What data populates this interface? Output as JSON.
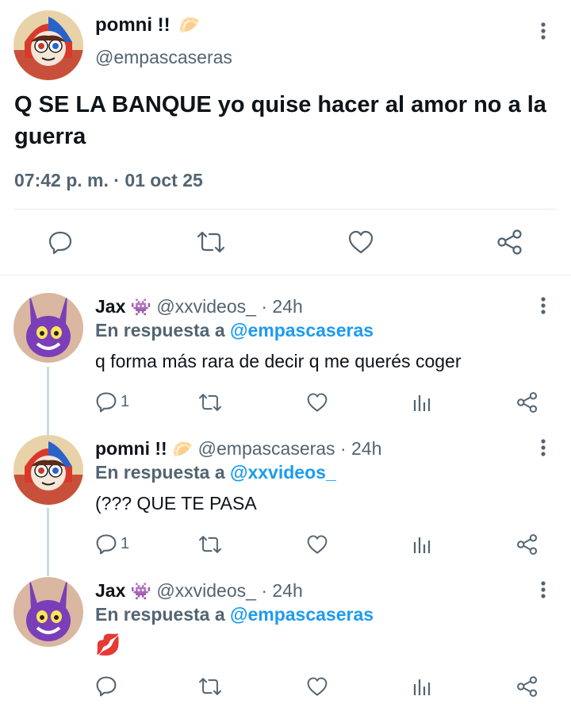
{
  "main_tweet": {
    "display_name": "pomni !!",
    "emoji": "🥟",
    "handle": "@empascaseras",
    "text": "Q SE LA BANQUE yo quise hacer al amor no a la guerra",
    "timestamp": "07:42 p. m. · 01 oct 25",
    "avatar_icon": "pomni-avatar"
  },
  "replies": [
    {
      "display_name": "Jax",
      "emoji": "👾",
      "handle": "@xxvideos_",
      "time": "· 24h",
      "in_reply_prefix": "En respuesta a",
      "in_reply_to": "@empascaseras",
      "text": "q forma más rara de decir q me querés coger",
      "reply_count": "1",
      "avatar_icon": "jax-avatar"
    },
    {
      "display_name": "pomni !!",
      "emoji": "🥟",
      "handle": "@empascaseras",
      "time": "· 24h",
      "in_reply_prefix": "En respuesta a",
      "in_reply_to": "@xxvideos_",
      "text": "(??? QUE TE PASA",
      "reply_count": "1",
      "avatar_icon": "pomni-avatar"
    },
    {
      "display_name": "Jax",
      "emoji": "👾",
      "handle": "@xxvideos_",
      "time": "· 24h",
      "in_reply_prefix": "En respuesta a",
      "in_reply_to": "@empascaseras",
      "text": "💋",
      "reply_count": "",
      "avatar_icon": "jax-avatar"
    }
  ],
  "colors": {
    "link": "#1d9bf0",
    "muted": "#536471",
    "text": "#0f1419",
    "divider": "#e6ecf0",
    "thread_line": "#cfd9de"
  }
}
